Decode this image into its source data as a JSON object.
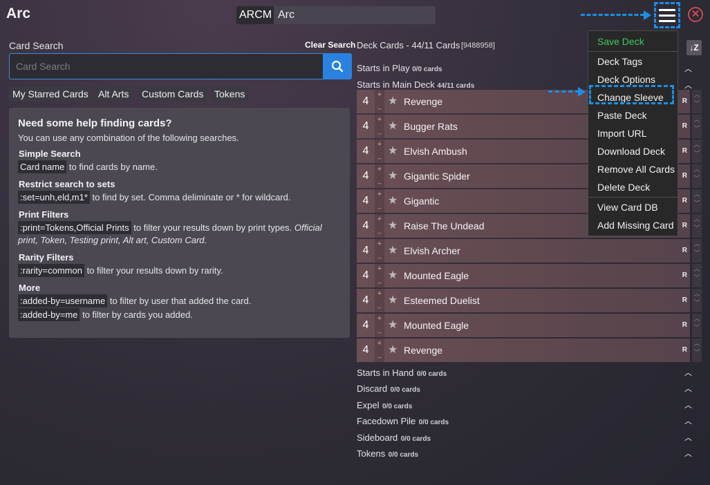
{
  "header": {
    "title": "Arc",
    "name_prefix": "ARCM",
    "deck_name_value": "Arc",
    "close_symbol": "✕"
  },
  "search": {
    "label": "Card Search",
    "clear_label": "Clear Search",
    "placeholder": "Card Search",
    "value": "",
    "tabs": [
      "My Starred Cards",
      "Alt Arts",
      "Custom Cards",
      "Tokens"
    ]
  },
  "help": {
    "title": "Need some help finding cards?",
    "intro": "You can use any combination of the following searches.",
    "simple_title": "Simple Search",
    "simple_code": "Card name",
    "simple_text": " to find cards by name.",
    "sets_title": "Restrict search to sets",
    "sets_code": ":set=unh,eld,m1*",
    "sets_text": " to find by set. Comma deliminate or * for wildcard.",
    "print_title": "Print Filters",
    "print_code": ":print=Tokens,Official Prints",
    "print_text": " to filter your results down by print types. ",
    "print_italic": "Official print, Token, Testing print, Alt art, Custom Card.",
    "rarity_title": "Rarity Filters",
    "rarity_code": ":rarity=common",
    "rarity_text": " to filter your results down by rarity.",
    "more_title": "More",
    "more_code1": ":added-by=username",
    "more_text1": " to filter by user that added the card.",
    "more_code2": ":added-by=me",
    "more_text2": " to filter by cards you added."
  },
  "deck": {
    "count_label": "Deck Cards - 44/11 Cards",
    "id_label": "[9488958]",
    "sort_symbol": "↓Z",
    "zones_top": [
      {
        "label": "Starts in Play",
        "count": "0/0 cards"
      },
      {
        "label": "Starts in Main Deck",
        "count": "44/11 cards"
      }
    ],
    "cards": [
      {
        "qty": "4",
        "name": "Revenge",
        "tag": "R"
      },
      {
        "qty": "4",
        "name": "Bugger Rats",
        "tag": "R"
      },
      {
        "qty": "4",
        "name": "Elvish Ambush",
        "tag": "R"
      },
      {
        "qty": "4",
        "name": "Gigantic Spider",
        "tag": "R"
      },
      {
        "qty": "4",
        "name": "Gigantic",
        "tag": "R"
      },
      {
        "qty": "4",
        "name": "Raise The Undead",
        "tag": "R"
      },
      {
        "qty": "4",
        "name": "Elvish Archer",
        "tag": "R"
      },
      {
        "qty": "4",
        "name": "Mounted Eagle",
        "tag": "R"
      },
      {
        "qty": "4",
        "name": "Esteemed Duelist",
        "tag": "R"
      },
      {
        "qty": "4",
        "name": "Mounted Eagle",
        "tag": "R"
      },
      {
        "qty": "4",
        "name": "Revenge",
        "tag": "R"
      }
    ],
    "zones_bottom": [
      {
        "label": "Starts in Hand",
        "count": "0/0 cards"
      },
      {
        "label": "Discard",
        "count": "0/0 cards"
      },
      {
        "label": "Expel",
        "count": "0/0 cards"
      },
      {
        "label": "Facedown Pile",
        "count": "0/0 cards"
      },
      {
        "label": "Sideboard",
        "count": "0/0 cards"
      },
      {
        "label": "Tokens",
        "count": "0/0 cards"
      }
    ]
  },
  "menu": {
    "items": [
      {
        "label": "Save Deck",
        "style": "green"
      },
      {
        "label": "Deck Tags"
      },
      {
        "label": "Deck Options"
      },
      {
        "label": "Change Sleeve"
      },
      {
        "label": "Paste Deck"
      },
      {
        "label": "Import URL"
      },
      {
        "label": "Download Deck"
      },
      {
        "label": "Remove All Cards"
      },
      {
        "label": "Delete Deck"
      },
      {
        "label": "View Card DB"
      },
      {
        "label": "Add Missing Card"
      }
    ]
  },
  "colors": {
    "accent": "#2a82e0",
    "annotation": "#1a8fe8",
    "save_green": "#3fc866",
    "close_red": "#c94a52"
  }
}
